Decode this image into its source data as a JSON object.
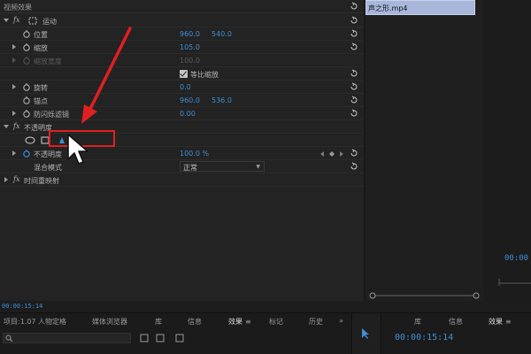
{
  "effect_controls": {
    "header": "视频效果",
    "motion": {
      "fx": "fx",
      "label": "运动"
    },
    "position": {
      "label": "位置",
      "x": "960.0",
      "y": "540.0"
    },
    "scale": {
      "label": "缩放",
      "value": "105.0"
    },
    "scale_width": {
      "label": "缩放宽度",
      "value": "100.0"
    },
    "uniform_scale": {
      "label": "等比缩放",
      "checked": true
    },
    "rotation": {
      "label": "旋转",
      "value": "0.0"
    },
    "anchor": {
      "label": "锚点",
      "x": "960.0",
      "y": "536.0"
    },
    "anti_flicker": {
      "label": "防闪烁滤镜",
      "value": "0.00"
    },
    "opacity_group": {
      "fx": "fx",
      "label": "不透明度"
    },
    "opacity": {
      "label": "不透明度",
      "value": "100.0 %"
    },
    "blend_mode": {
      "label": "混合模式",
      "value": "正常"
    },
    "time_remap": {
      "fx": "fx",
      "label": "时间重映射"
    }
  },
  "timeline": {
    "clip_name": "声之形.mp4"
  },
  "program_time": "00:00",
  "playhead_time": "00:00:15:14",
  "bottom_tabs": [
    {
      "label": "项目:1.07 人物定格",
      "active": false
    },
    {
      "label": "媒体浏览器",
      "active": false
    },
    {
      "label": "库",
      "active": false
    },
    {
      "label": "信息",
      "active": false
    },
    {
      "label": "效果",
      "active": true,
      "menu": "≡"
    },
    {
      "label": "标记",
      "active": false
    },
    {
      "label": "历史",
      "active": false
    },
    {
      "label": "»",
      "active": false
    }
  ],
  "right_tabs": [
    {
      "label": "库"
    },
    {
      "label": "信息"
    },
    {
      "label": "效果",
      "menu": "≡"
    }
  ],
  "right_time": "00:00:15:14",
  "colors": {
    "accent": "#3f8fd6",
    "highlight": "#e02020",
    "clip": "#a8b7d9"
  },
  "icons": [
    "stopwatch-icon",
    "reset-icon",
    "twirl-icon",
    "ellipse-mask-icon",
    "rect-mask-icon",
    "pen-mask-icon",
    "selection-tool-icon",
    "mouse-cursor-icon"
  ]
}
